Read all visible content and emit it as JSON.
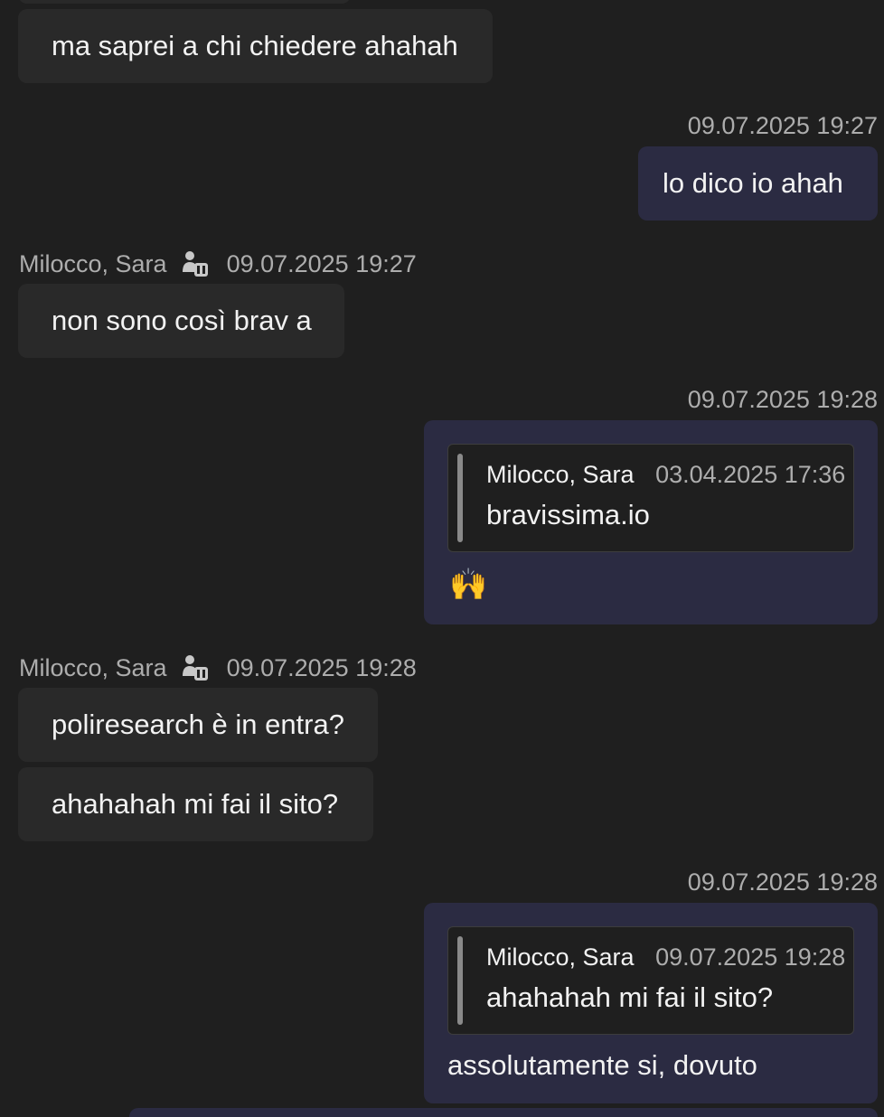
{
  "messages": {
    "m1": {
      "text": "ma saprei a chi chiedere ahahah"
    },
    "m2": {
      "timestamp": "09.07.2025 19:27",
      "text": "lo dico io ahah"
    },
    "m3": {
      "sender": "Milocco, Sara",
      "timestamp": "09.07.2025 19:27",
      "text": "non sono così brav a"
    },
    "m4": {
      "timestamp": "09.07.2025 19:28",
      "quote": {
        "author": "Milocco, Sara",
        "time": "03.04.2025 17:36",
        "text": "bravissima.io"
      },
      "emoji": "🙌"
    },
    "m5": {
      "sender": "Milocco, Sara",
      "timestamp": "09.07.2025 19:28",
      "text1": "poliresearch è in entra?",
      "text2": "ahahahah mi fai il sito?"
    },
    "m6": {
      "timestamp": "09.07.2025 19:28",
      "quote": {
        "author": "Milocco, Sara",
        "time": "09.07.2025 19:28",
        "text": "ahahahah mi fai il sito?"
      },
      "text": "assolutamente si, dovuto"
    }
  },
  "icons": {
    "presence": "presence-away-icon"
  },
  "colors": {
    "background": "#1f1f1f",
    "incoming_bubble": "#292929",
    "outgoing_bubble": "#2b2b42",
    "meta_text": "#adadad"
  }
}
